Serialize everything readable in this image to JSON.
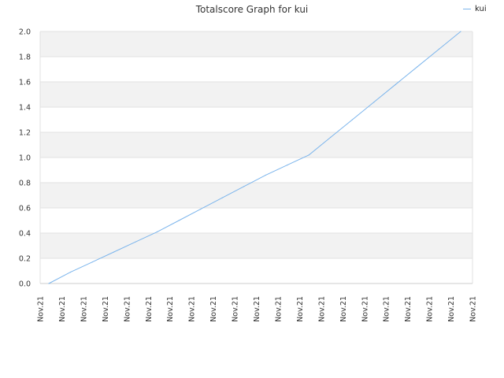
{
  "chart_data": {
    "type": "line",
    "title": "Totalscore Graph for kui",
    "xlabel": "",
    "ylabel": "",
    "x": [
      "Nov.21",
      "Nov.21",
      "Nov.21",
      "Nov.21",
      "Nov.21",
      "Nov.21",
      "Nov.21",
      "Nov.21",
      "Nov.21",
      "Nov.21",
      "Nov.21",
      "Nov.21",
      "Nov.21",
      "Nov.21",
      "Nov.21",
      "Nov.21",
      "Nov.21",
      "Nov.21",
      "Nov.21",
      "Nov.21",
      "Nov.21"
    ],
    "ylim": [
      0,
      2.0
    ],
    "yticks": [
      "0.0",
      "0.2",
      "0.4",
      "0.6",
      "0.8",
      "1.0",
      "1.2",
      "1.4",
      "1.6",
      "1.8",
      "2.0"
    ],
    "grid": true,
    "legend_position": "top-right",
    "series": [
      {
        "name": "kui",
        "color": "#7cb5ec",
        "values": [
          0,
          0.09,
          0.17,
          0.25,
          0.33,
          0.41,
          0.5,
          0.59,
          0.68,
          0.77,
          0.86,
          0.94,
          1.02,
          1.16,
          1.3,
          1.44,
          1.58,
          1.72,
          1.86,
          2.0
        ]
      }
    ]
  }
}
